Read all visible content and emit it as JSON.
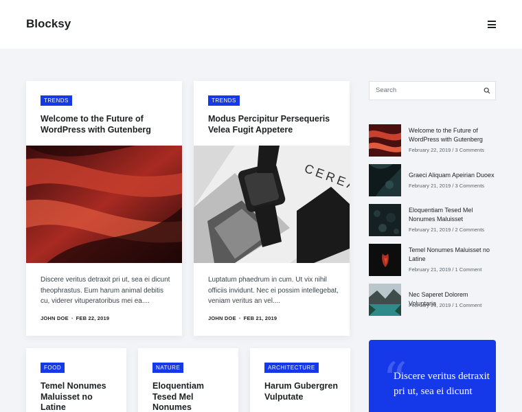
{
  "header": {
    "logo": "Blocksy",
    "menu_icon": "hamburger-menu-icon"
  },
  "posts": [
    {
      "tag": "TRENDS",
      "title": "Welcome to the Future of WordPress with Gutenberg",
      "excerpt": "Discere veritus detraxit pri ut, sea ei dicunt theophrastus. Eum harum animal debitis cu, viderer vituperatoribus mei ea....",
      "author": "JOHN DOE",
      "date": "FEB 22, 2019"
    },
    {
      "tag": "TRENDS",
      "title": "Modus Percipitur Persequeris Velea Fugit Appetere",
      "excerpt": "Luptatum phaedrum in cum. Ut vix nihil officiis invidunt. Nec ei possim intellegebat, veniam veritus an vel....",
      "author": "JOHN DOE",
      "date": "FEB 21, 2019"
    },
    {
      "tag": "FOOD",
      "title": "Temel Nonumes Maluisset no Latine"
    },
    {
      "tag": "NATURE",
      "title": "Eloquentiam Tesed Mel Nonumes"
    },
    {
      "tag": "ARCHITECTURE",
      "title": "Harum Gubergren Vulputate"
    }
  ],
  "sidebar": {
    "search_placeholder": "Search",
    "recent": [
      {
        "title": "Welcome to the Future of WordPress with Gutenberg",
        "meta": "February 22, 2019 / 3 Comments"
      },
      {
        "title": "Graeci Aliquam Apeirian Duoex",
        "meta": "February 21, 2019 / 3 Comments"
      },
      {
        "title": "Eloquentiam Tesed Mel Nonumes Maluisset",
        "meta": "February 21, 2019 / 2 Comments"
      },
      {
        "title": "Temel Nonumes Maluisset no Latine",
        "meta": "February 21, 2019 / 1 Comment"
      },
      {
        "title": "Nec Saperet Dolorem Voluptaria",
        "meta": "February 21, 2019 / 1 Comment"
      }
    ],
    "quote": "Discere veritus detraxit pri ut, sea ei dicunt"
  },
  "colors": {
    "accent": "#1539e8",
    "page_bg": "#f2f4f7",
    "text": "#1d2023"
  }
}
